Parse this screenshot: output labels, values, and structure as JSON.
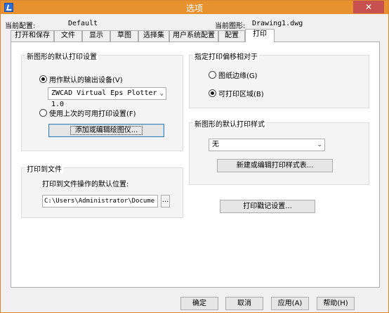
{
  "window": {
    "title": "选项",
    "close_label": "✕"
  },
  "header": {
    "profile_label": "当前配置:",
    "profile_value": "Default",
    "drawing_label": "当前图形:",
    "drawing_value": "Drawing1.dwg"
  },
  "tabs": [
    {
      "label": "打开和保存"
    },
    {
      "label": "文件"
    },
    {
      "label": "显示"
    },
    {
      "label": "草图"
    },
    {
      "label": "选择集"
    },
    {
      "label": "用户系统配置"
    },
    {
      "label": "配置"
    },
    {
      "label": "打印",
      "active": true
    }
  ],
  "default_print": {
    "title": "新图形的默认打印设置",
    "use_default_device": "用作默认的输出设备(V)",
    "device_selected": "ZWCAD Virtual Eps Plotter 1.0",
    "use_last_settings": "使用上次的可用打印设置(F)",
    "add_plotter_button": "添加或编辑绘图仪..."
  },
  "print_to_file": {
    "title": "打印到文件",
    "location_label": "打印到文件操作的默认位置:",
    "location_value": "C:\\Users\\Administrator\\Docume",
    "browse_button": "..."
  },
  "offset": {
    "title": "指定打印偏移相对于",
    "paper_edge": "图纸边缘(G)",
    "printable_area": "可打印区域(B)"
  },
  "plot_style": {
    "title": "新图形的默认打印样式",
    "selected": "无",
    "edit_button": "新建或编辑打印样式表..."
  },
  "stamp_button": "打印戳记设置...",
  "footer": {
    "ok": "确定",
    "cancel": "取消",
    "apply": "应用(A)",
    "help": "帮助(H)"
  }
}
